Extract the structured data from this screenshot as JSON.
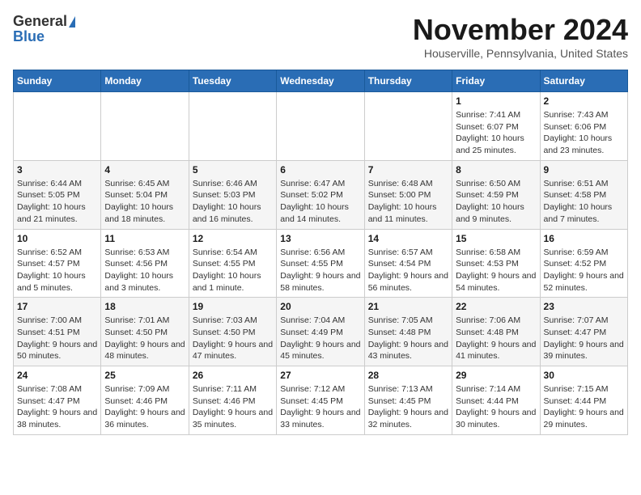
{
  "header": {
    "logo_general": "General",
    "logo_blue": "Blue",
    "month_title": "November 2024",
    "location": "Houserville, Pennsylvania, United States"
  },
  "days_of_week": [
    "Sunday",
    "Monday",
    "Tuesday",
    "Wednesday",
    "Thursday",
    "Friday",
    "Saturday"
  ],
  "weeks": [
    [
      {
        "day": "",
        "info": ""
      },
      {
        "day": "",
        "info": ""
      },
      {
        "day": "",
        "info": ""
      },
      {
        "day": "",
        "info": ""
      },
      {
        "day": "",
        "info": ""
      },
      {
        "day": "1",
        "info": "Sunrise: 7:41 AM\nSunset: 6:07 PM\nDaylight: 10 hours and 25 minutes."
      },
      {
        "day": "2",
        "info": "Sunrise: 7:43 AM\nSunset: 6:06 PM\nDaylight: 10 hours and 23 minutes."
      }
    ],
    [
      {
        "day": "3",
        "info": "Sunrise: 6:44 AM\nSunset: 5:05 PM\nDaylight: 10 hours and 21 minutes."
      },
      {
        "day": "4",
        "info": "Sunrise: 6:45 AM\nSunset: 5:04 PM\nDaylight: 10 hours and 18 minutes."
      },
      {
        "day": "5",
        "info": "Sunrise: 6:46 AM\nSunset: 5:03 PM\nDaylight: 10 hours and 16 minutes."
      },
      {
        "day": "6",
        "info": "Sunrise: 6:47 AM\nSunset: 5:02 PM\nDaylight: 10 hours and 14 minutes."
      },
      {
        "day": "7",
        "info": "Sunrise: 6:48 AM\nSunset: 5:00 PM\nDaylight: 10 hours and 11 minutes."
      },
      {
        "day": "8",
        "info": "Sunrise: 6:50 AM\nSunset: 4:59 PM\nDaylight: 10 hours and 9 minutes."
      },
      {
        "day": "9",
        "info": "Sunrise: 6:51 AM\nSunset: 4:58 PM\nDaylight: 10 hours and 7 minutes."
      }
    ],
    [
      {
        "day": "10",
        "info": "Sunrise: 6:52 AM\nSunset: 4:57 PM\nDaylight: 10 hours and 5 minutes."
      },
      {
        "day": "11",
        "info": "Sunrise: 6:53 AM\nSunset: 4:56 PM\nDaylight: 10 hours and 3 minutes."
      },
      {
        "day": "12",
        "info": "Sunrise: 6:54 AM\nSunset: 4:55 PM\nDaylight: 10 hours and 1 minute."
      },
      {
        "day": "13",
        "info": "Sunrise: 6:56 AM\nSunset: 4:55 PM\nDaylight: 9 hours and 58 minutes."
      },
      {
        "day": "14",
        "info": "Sunrise: 6:57 AM\nSunset: 4:54 PM\nDaylight: 9 hours and 56 minutes."
      },
      {
        "day": "15",
        "info": "Sunrise: 6:58 AM\nSunset: 4:53 PM\nDaylight: 9 hours and 54 minutes."
      },
      {
        "day": "16",
        "info": "Sunrise: 6:59 AM\nSunset: 4:52 PM\nDaylight: 9 hours and 52 minutes."
      }
    ],
    [
      {
        "day": "17",
        "info": "Sunrise: 7:00 AM\nSunset: 4:51 PM\nDaylight: 9 hours and 50 minutes."
      },
      {
        "day": "18",
        "info": "Sunrise: 7:01 AM\nSunset: 4:50 PM\nDaylight: 9 hours and 48 minutes."
      },
      {
        "day": "19",
        "info": "Sunrise: 7:03 AM\nSunset: 4:50 PM\nDaylight: 9 hours and 47 minutes."
      },
      {
        "day": "20",
        "info": "Sunrise: 7:04 AM\nSunset: 4:49 PM\nDaylight: 9 hours and 45 minutes."
      },
      {
        "day": "21",
        "info": "Sunrise: 7:05 AM\nSunset: 4:48 PM\nDaylight: 9 hours and 43 minutes."
      },
      {
        "day": "22",
        "info": "Sunrise: 7:06 AM\nSunset: 4:48 PM\nDaylight: 9 hours and 41 minutes."
      },
      {
        "day": "23",
        "info": "Sunrise: 7:07 AM\nSunset: 4:47 PM\nDaylight: 9 hours and 39 minutes."
      }
    ],
    [
      {
        "day": "24",
        "info": "Sunrise: 7:08 AM\nSunset: 4:47 PM\nDaylight: 9 hours and 38 minutes."
      },
      {
        "day": "25",
        "info": "Sunrise: 7:09 AM\nSunset: 4:46 PM\nDaylight: 9 hours and 36 minutes."
      },
      {
        "day": "26",
        "info": "Sunrise: 7:11 AM\nSunset: 4:46 PM\nDaylight: 9 hours and 35 minutes."
      },
      {
        "day": "27",
        "info": "Sunrise: 7:12 AM\nSunset: 4:45 PM\nDaylight: 9 hours and 33 minutes."
      },
      {
        "day": "28",
        "info": "Sunrise: 7:13 AM\nSunset: 4:45 PM\nDaylight: 9 hours and 32 minutes."
      },
      {
        "day": "29",
        "info": "Sunrise: 7:14 AM\nSunset: 4:44 PM\nDaylight: 9 hours and 30 minutes."
      },
      {
        "day": "30",
        "info": "Sunrise: 7:15 AM\nSunset: 4:44 PM\nDaylight: 9 hours and 29 minutes."
      }
    ]
  ]
}
